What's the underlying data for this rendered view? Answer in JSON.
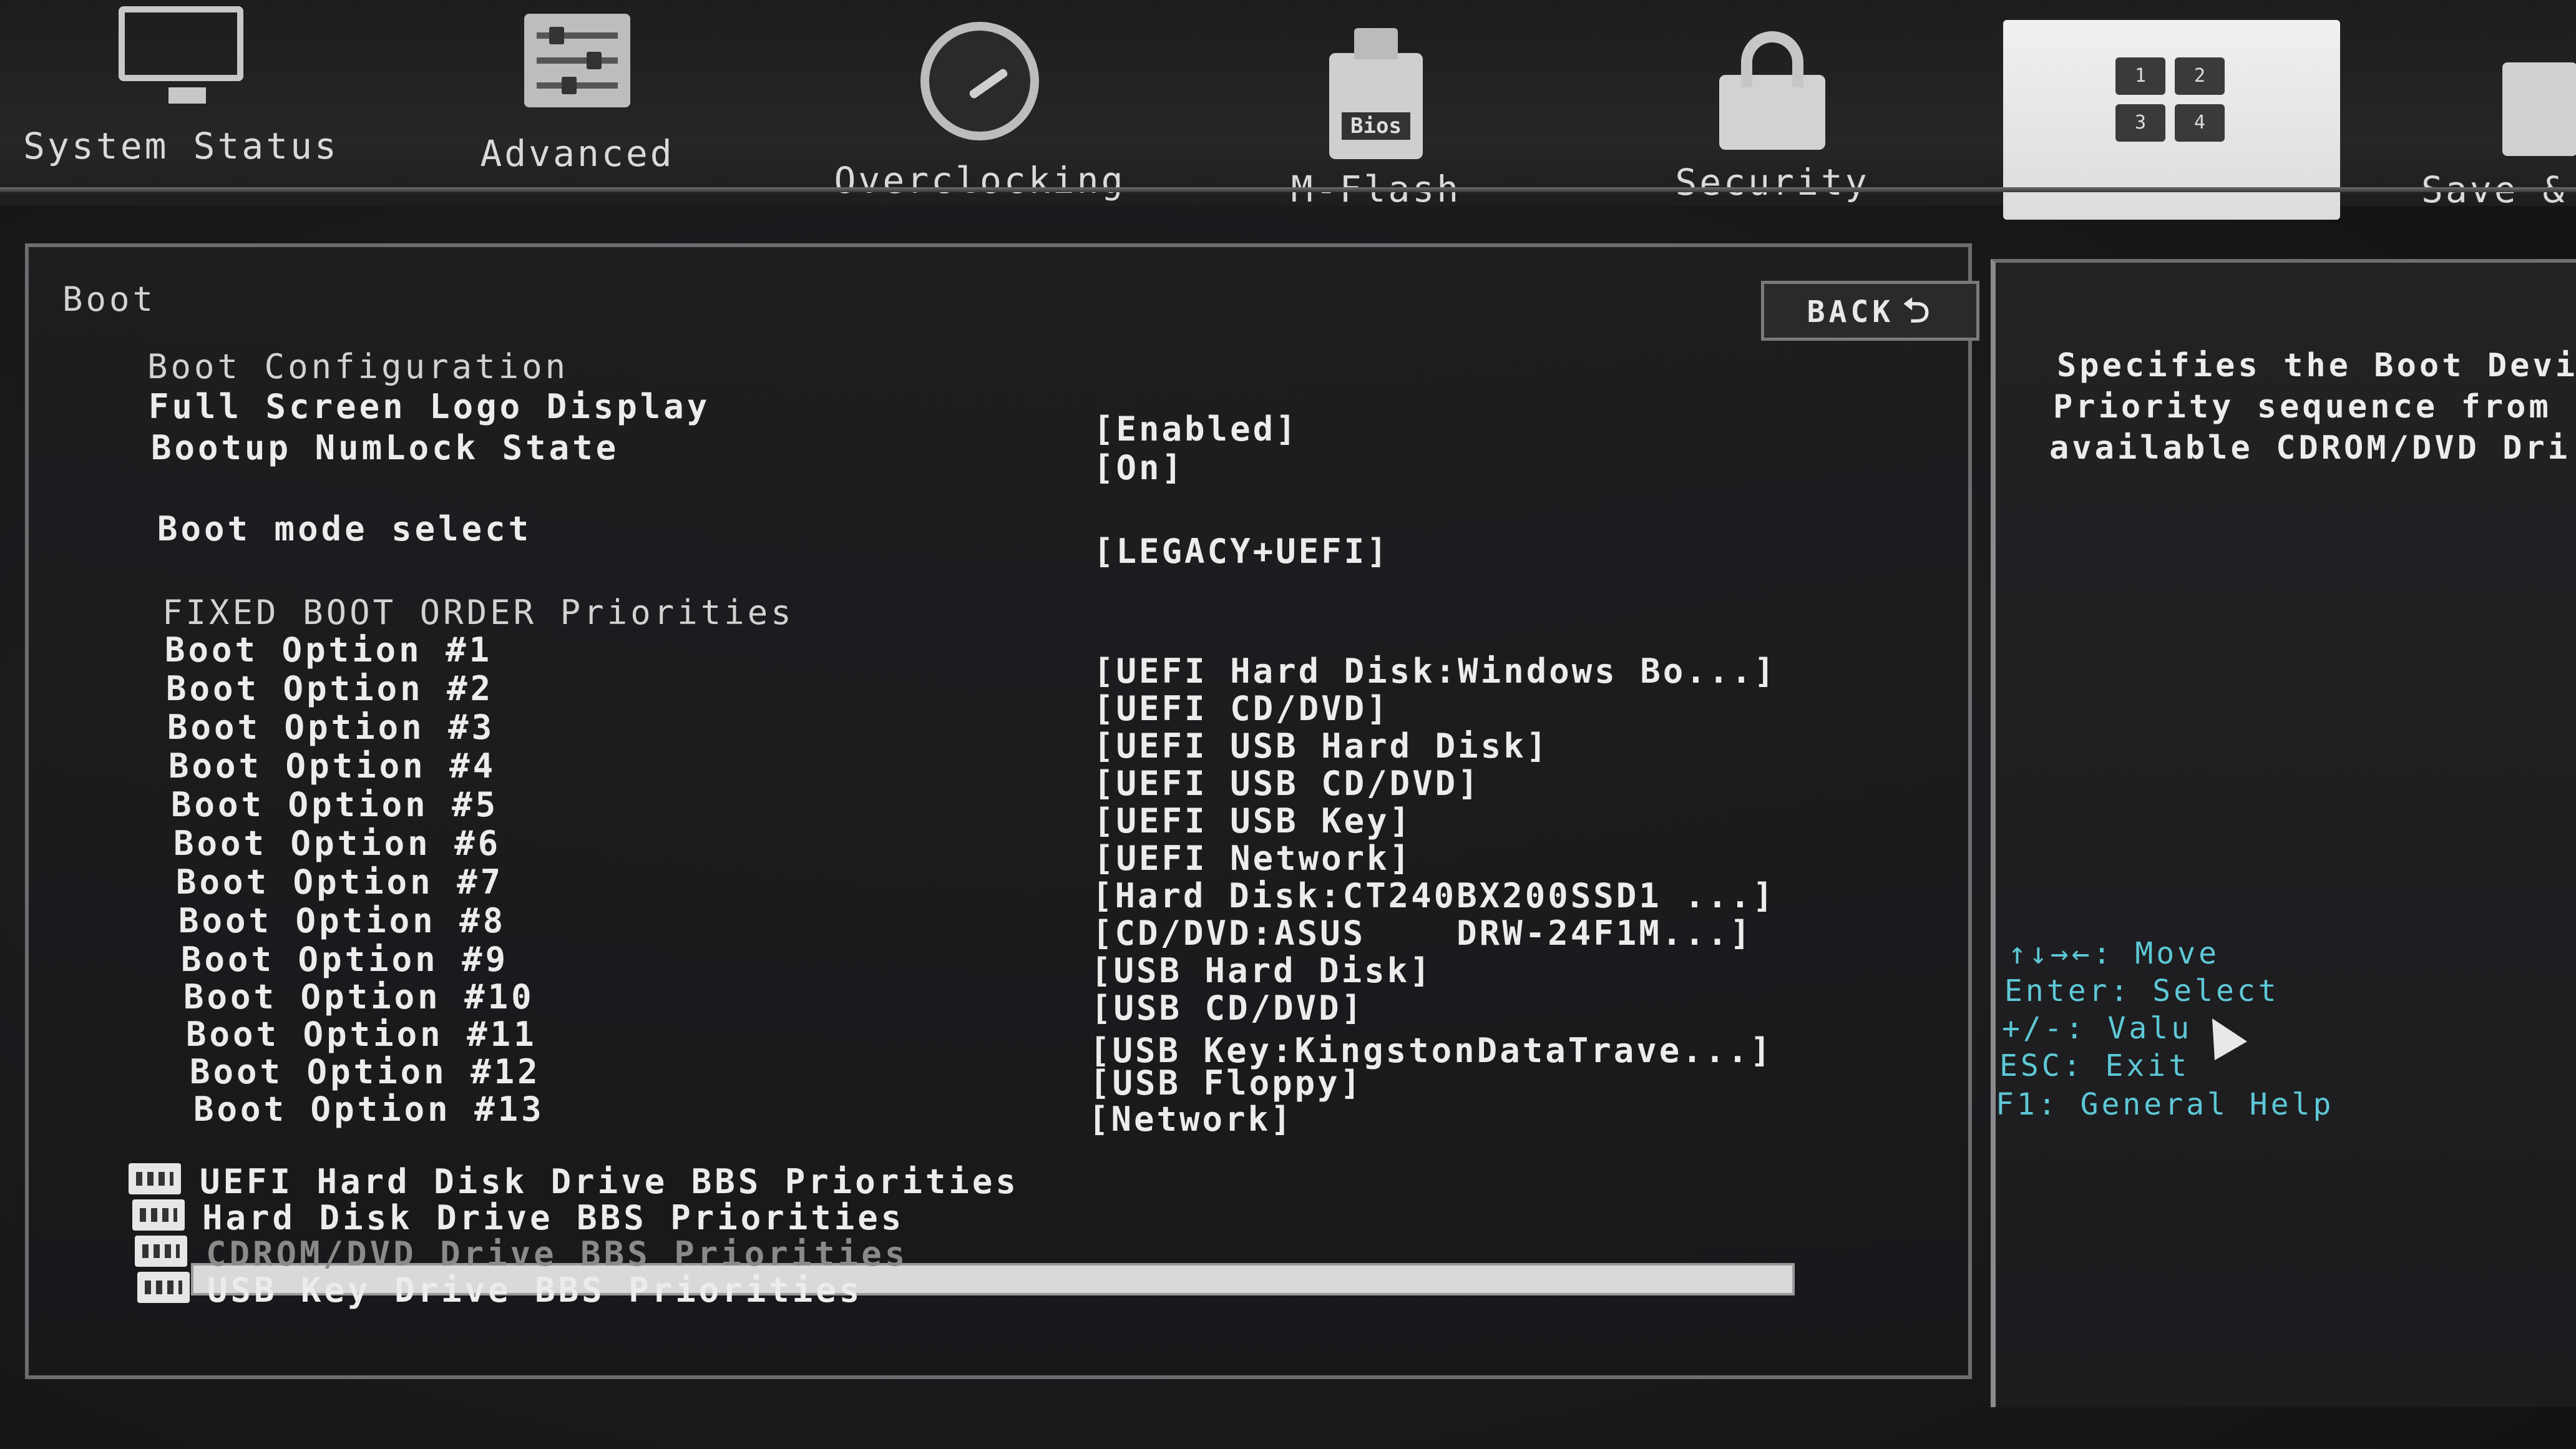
{
  "nav": {
    "tabs": [
      {
        "label": "System Status",
        "icon": "monitor-icon"
      },
      {
        "label": "Advanced",
        "icon": "sliders-icon"
      },
      {
        "label": "Overclocking",
        "icon": "gauge-icon"
      },
      {
        "label": "M-Flash",
        "icon": "usb-bios-icon",
        "icon_text": "Bios"
      },
      {
        "label": "Security",
        "icon": "lock-icon"
      },
      {
        "label": "",
        "icon": "boot-order-icon",
        "active": true,
        "icon_text": [
          "1",
          "2",
          "3",
          "4"
        ]
      },
      {
        "label": "Save &",
        "icon": "save-icon"
      }
    ]
  },
  "main": {
    "section_title": "Boot",
    "back_label": "BACK",
    "settings": [
      {
        "label": "Boot Configuration",
        "value": ""
      },
      {
        "label": "Full Screen Logo Display",
        "value": "[Enabled]"
      },
      {
        "label": "Bootup NumLock State",
        "value": "[On]"
      },
      {
        "label": "Boot mode select",
        "value": "[LEGACY+UEFI]"
      },
      {
        "label": "FIXED BOOT ORDER Priorities",
        "value": ""
      }
    ],
    "boot_options": [
      {
        "label": "Boot Option #1",
        "value": "[UEFI Hard Disk:Windows Bo...]"
      },
      {
        "label": "Boot Option #2",
        "value": "[UEFI CD/DVD]"
      },
      {
        "label": "Boot Option #3",
        "value": "[UEFI USB Hard Disk]"
      },
      {
        "label": "Boot Option #4",
        "value": "[UEFI USB CD/DVD]"
      },
      {
        "label": "Boot Option #5",
        "value": "[UEFI USB Key]"
      },
      {
        "label": "Boot Option #6",
        "value": "[UEFI Network]"
      },
      {
        "label": "Boot Option #7",
        "value": "[Hard Disk:CT240BX200SSD1 ...]"
      },
      {
        "label": "Boot Option #8",
        "value": "[CD/DVD:ASUS    DRW-24F1M...]"
      },
      {
        "label": "Boot Option #9",
        "value": "[USB Hard Disk]"
      },
      {
        "label": "Boot Option #10",
        "value": "[USB CD/DVD]"
      },
      {
        "label": "Boot Option #11",
        "value": "[USB Key:KingstonDataTrave...]"
      },
      {
        "label": "Boot Option #12",
        "value": "[USB Floppy]"
      },
      {
        "label": "Boot Option #13",
        "value": "[Network]"
      }
    ],
    "bbs_priorities": [
      {
        "label": "UEFI Hard Disk Drive BBS Priorities",
        "selected": false
      },
      {
        "label": "Hard Disk Drive BBS Priorities",
        "selected": false
      },
      {
        "label": "CDROM/DVD Drive BBS Priorities",
        "selected": true
      },
      {
        "label": "USB Key Drive BBS Priorities",
        "selected": false
      }
    ]
  },
  "help": {
    "description": [
      "Specifies the Boot Devi",
      "Priority sequence from",
      "available CDROM/DVD Dri"
    ],
    "keys": [
      "↑↓→←: Move",
      "Enter: Select",
      "+/-: Valu",
      "ESC: Exit",
      "F1: General Help"
    ]
  },
  "colors": {
    "help_text": "#5ec8d6",
    "highlight_bar": "#d9d9d9",
    "active_tab": "#e6e6e6"
  }
}
